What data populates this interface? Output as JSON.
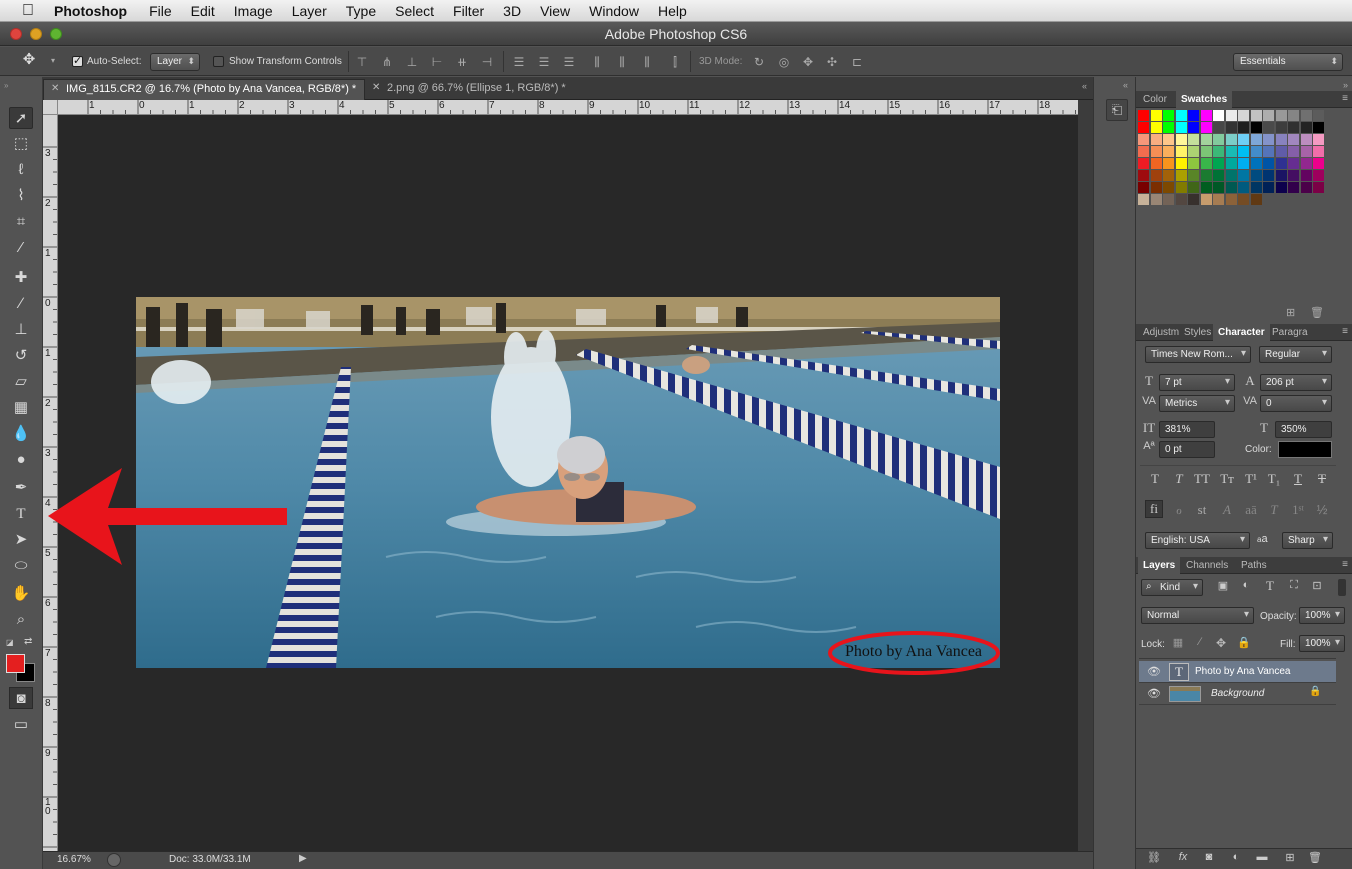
{
  "menubar": {
    "app": "Photoshop",
    "items": [
      "File",
      "Edit",
      "Image",
      "Layer",
      "Type",
      "Select",
      "Filter",
      "3D",
      "View",
      "Window",
      "Help"
    ]
  },
  "window": {
    "title": "Adobe Photoshop CS6"
  },
  "options": {
    "auto_select_label": "Auto-Select:",
    "auto_select_value": "Layer",
    "transform_label": "Show Transform Controls",
    "mode_3d_label": "3D Mode:",
    "workspace": "Essentials"
  },
  "tabs": [
    {
      "label": "IMG_8115.CR2 @ 16.7% (Photo by Ana Vancea, RGB/8*) *"
    },
    {
      "label": "2.png @ 66.7% (Ellipse 1, RGB/8*) *"
    }
  ],
  "ruler": {
    "h": [
      "1",
      "0",
      "1",
      "2",
      "3",
      "4",
      "5",
      "6",
      "7",
      "8",
      "9",
      "10",
      "11",
      "12",
      "13",
      "14",
      "15",
      "16",
      "17",
      "18"
    ],
    "v": [
      "3",
      "2",
      "1",
      "0",
      "1",
      "2",
      "3",
      "4",
      "5",
      "6",
      "7",
      "8",
      "9",
      "1\n0"
    ]
  },
  "image": {
    "watermark": "Photo by Ana Vancea"
  },
  "status": {
    "zoom": "16.67%",
    "doc": "Doc: 33.0M/33.1M"
  },
  "colors": {
    "foreground": "#e41f1f",
    "background": "#000000",
    "annotation": "#e8141b"
  },
  "swatch_panel": {
    "tabs": [
      "Color",
      "Swatches"
    ]
  },
  "character_panel": {
    "tabs": [
      "Adjustm",
      "Styles",
      "Character",
      "Paragra"
    ],
    "font_family": "Times New Rom...",
    "font_style": "Regular",
    "font_size": "7 pt",
    "leading": "206 pt",
    "kerning": "Metrics",
    "tracking": "0",
    "vertical_scale": "381%",
    "horizontal_scale": "350%",
    "baseline_shift": "0 pt",
    "color_label": "Color:",
    "language": "English: USA",
    "aa_label": "a",
    "antialias": "Sharp"
  },
  "layers_panel": {
    "tabs": [
      "Layers",
      "Channels",
      "Paths"
    ],
    "filter": "Kind",
    "blend_mode": "Normal",
    "opacity_label": "Opacity:",
    "opacity": "100%",
    "lock_label": "Lock:",
    "fill_label": "Fill:",
    "fill": "100%",
    "layers": [
      {
        "name": "Photo by Ana Vancea",
        "type": "text"
      },
      {
        "name": "Background",
        "type": "image"
      }
    ]
  }
}
